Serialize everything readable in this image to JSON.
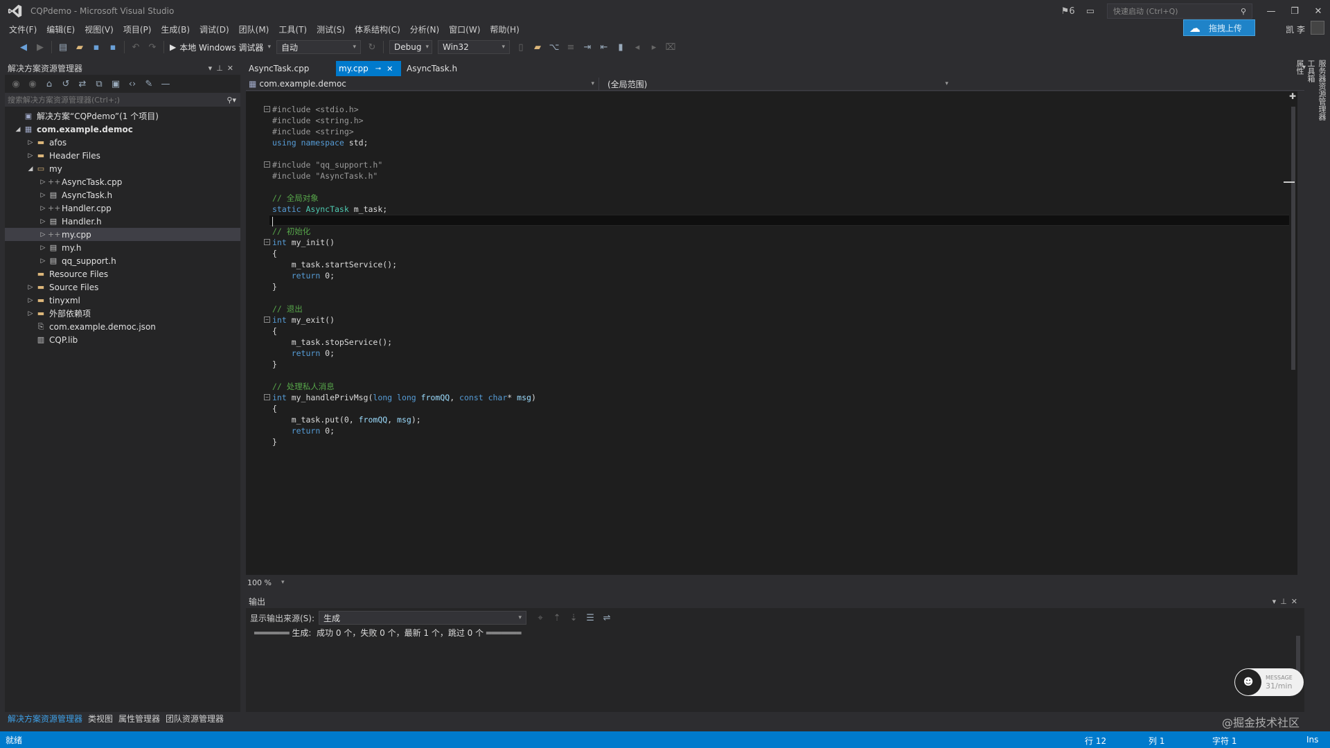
{
  "window": {
    "title": "CQPdemo - Microsoft Visual Studio",
    "notification_count": "6",
    "quick_launch_placeholder": "快速启动 (Ctrl+Q)",
    "upload_label": "拖拽上传",
    "user_name": "凯 李"
  },
  "menu": [
    "文件(F)",
    "编辑(E)",
    "视图(V)",
    "项目(P)",
    "生成(B)",
    "调试(D)",
    "团队(M)",
    "工具(T)",
    "测试(S)",
    "体系结构(C)",
    "分析(N)",
    "窗口(W)",
    "帮助(H)"
  ],
  "toolbar": {
    "run_label": "本地 Windows 调试器",
    "run_mode": "自动",
    "configuration": "Debug",
    "platform": "Win32"
  },
  "solution_explorer": {
    "title": "解决方案资源管理器",
    "search_placeholder": "搜索解决方案资源管理器(Ctrl+;)",
    "items": [
      {
        "label": "解决方案“CQPdemo”(1 个项目)",
        "depth": 0,
        "twisty": "",
        "icon": "solution-icon",
        "glyph": "▣",
        "cls": "ic-proj",
        "bold": false,
        "selected": false
      },
      {
        "label": "com.example.democ",
        "depth": 0,
        "twisty": "◢",
        "icon": "project-icon",
        "glyph": "▦",
        "cls": "ic-proj",
        "bold": true,
        "selected": false
      },
      {
        "label": "afos",
        "depth": 1,
        "twisty": "▷",
        "icon": "folder-icon",
        "glyph": "▬",
        "cls": "ic-folder",
        "bold": false,
        "selected": false
      },
      {
        "label": "Header Files",
        "depth": 1,
        "twisty": "▷",
        "icon": "folder-icon",
        "glyph": "▬",
        "cls": "ic-folder",
        "bold": false,
        "selected": false
      },
      {
        "label": "my",
        "depth": 1,
        "twisty": "◢",
        "icon": "folder-open-icon",
        "glyph": "▭",
        "cls": "ic-folder",
        "bold": false,
        "selected": false
      },
      {
        "label": "AsyncTask.cpp",
        "depth": 2,
        "twisty": "▷",
        "icon": "cpp-file-icon",
        "glyph": "++",
        "cls": "ic-cpp",
        "bold": false,
        "selected": false
      },
      {
        "label": "AsyncTask.h",
        "depth": 2,
        "twisty": "▷",
        "icon": "header-file-icon",
        "glyph": "▤",
        "cls": "ic-file",
        "bold": false,
        "selected": false
      },
      {
        "label": "Handler.cpp",
        "depth": 2,
        "twisty": "▷",
        "icon": "cpp-file-icon",
        "glyph": "++",
        "cls": "ic-cpp",
        "bold": false,
        "selected": false
      },
      {
        "label": "Handler.h",
        "depth": 2,
        "twisty": "▷",
        "icon": "header-file-icon",
        "glyph": "▤",
        "cls": "ic-file",
        "bold": false,
        "selected": false
      },
      {
        "label": "my.cpp",
        "depth": 2,
        "twisty": "▷",
        "icon": "cpp-file-icon",
        "glyph": "++",
        "cls": "ic-cpp",
        "bold": false,
        "selected": true
      },
      {
        "label": "my.h",
        "depth": 2,
        "twisty": "▷",
        "icon": "header-file-icon",
        "glyph": "▤",
        "cls": "ic-file",
        "bold": false,
        "selected": false
      },
      {
        "label": "qq_support.h",
        "depth": 2,
        "twisty": "▷",
        "icon": "header-file-icon",
        "glyph": "▤",
        "cls": "ic-file",
        "bold": false,
        "selected": false
      },
      {
        "label": "Resource Files",
        "depth": 1,
        "twisty": "",
        "icon": "folder-icon",
        "glyph": "▬",
        "cls": "ic-folder",
        "bold": false,
        "selected": false
      },
      {
        "label": "Source Files",
        "depth": 1,
        "twisty": "▷",
        "icon": "folder-icon",
        "glyph": "▬",
        "cls": "ic-folder",
        "bold": false,
        "selected": false
      },
      {
        "label": "tinyxml",
        "depth": 1,
        "twisty": "▷",
        "icon": "folder-icon",
        "glyph": "▬",
        "cls": "ic-folder",
        "bold": false,
        "selected": false
      },
      {
        "label": "外部依赖项",
        "depth": 1,
        "twisty": "▷",
        "icon": "dependencies-icon",
        "glyph": "▬",
        "cls": "ic-folder",
        "bold": false,
        "selected": false
      },
      {
        "label": "com.example.democ.json",
        "depth": 1,
        "twisty": "",
        "icon": "json-file-icon",
        "glyph": "⎘",
        "cls": "ic-file",
        "bold": false,
        "selected": false
      },
      {
        "label": "CQP.lib",
        "depth": 1,
        "twisty": "",
        "icon": "lib-file-icon",
        "glyph": "▥",
        "cls": "ic-file",
        "bold": false,
        "selected": false
      }
    ],
    "bottom_tabs": [
      "解决方案资源管理器",
      "类视图",
      "属性管理器",
      "团队资源管理器"
    ]
  },
  "editor": {
    "tabs": [
      {
        "label": "AsyncTask.cpp",
        "active": false
      },
      {
        "label": "my.cpp",
        "active": true
      },
      {
        "label": "AsyncTask.h",
        "active": false
      }
    ],
    "nav_project": "com.example.democ",
    "nav_scope": "(全局范围)",
    "zoom": "100 %",
    "code_lines": [
      [
        {
          "t": "#include ",
          "c": "pp"
        },
        {
          "t": "<stdio.h>",
          "c": "pp"
        }
      ],
      [
        {
          "t": "#include ",
          "c": "pp"
        },
        {
          "t": "<string.h>",
          "c": "pp"
        }
      ],
      [
        {
          "t": "#include ",
          "c": "pp"
        },
        {
          "t": "<string>",
          "c": "pp"
        }
      ],
      [
        {
          "t": "using namespace",
          "c": "kw"
        },
        {
          "t": " std;",
          "c": "plain"
        }
      ],
      [],
      [
        {
          "t": "#include ",
          "c": "pp"
        },
        {
          "t": "\"qq_support.h\"",
          "c": "pp"
        }
      ],
      [
        {
          "t": "#include ",
          "c": "pp"
        },
        {
          "t": "\"AsyncTask.h\"",
          "c": "pp"
        }
      ],
      [],
      [
        {
          "t": "// 全局对象",
          "c": "cm"
        }
      ],
      [
        {
          "t": "static",
          "c": "kw"
        },
        {
          "t": " AsyncTask",
          "c": "ty"
        },
        {
          "t": " m_task;",
          "c": "plain"
        }
      ],
      [],
      [
        {
          "t": "// 初始化",
          "c": "cm"
        }
      ],
      [
        {
          "t": "int",
          "c": "kw"
        },
        {
          "t": " my_init()",
          "c": "plain"
        }
      ],
      [
        {
          "t": "{",
          "c": "plain"
        }
      ],
      [
        {
          "t": "    m_task.startService();",
          "c": "plain"
        }
      ],
      [
        {
          "t": "    ",
          "c": "plain"
        },
        {
          "t": "return",
          "c": "kw"
        },
        {
          "t": " 0;",
          "c": "plain"
        }
      ],
      [
        {
          "t": "}",
          "c": "plain"
        }
      ],
      [],
      [
        {
          "t": "// 退出",
          "c": "cm"
        }
      ],
      [
        {
          "t": "int",
          "c": "kw"
        },
        {
          "t": " my_exit()",
          "c": "plain"
        }
      ],
      [
        {
          "t": "{",
          "c": "plain"
        }
      ],
      [
        {
          "t": "    m_task.stopService();",
          "c": "plain"
        }
      ],
      [
        {
          "t": "    ",
          "c": "plain"
        },
        {
          "t": "return",
          "c": "kw"
        },
        {
          "t": " 0;",
          "c": "plain"
        }
      ],
      [
        {
          "t": "}",
          "c": "plain"
        }
      ],
      [],
      [
        {
          "t": "// 处理私人消息",
          "c": "cm"
        }
      ],
      [
        {
          "t": "int",
          "c": "kw"
        },
        {
          "t": " my_handlePrivMsg(",
          "c": "plain"
        },
        {
          "t": "long long",
          "c": "kw"
        },
        {
          "t": " fromQQ",
          "c": "par"
        },
        {
          "t": ", ",
          "c": "plain"
        },
        {
          "t": "const char",
          "c": "kw"
        },
        {
          "t": "* ",
          "c": "plain"
        },
        {
          "t": "msg",
          "c": "par"
        },
        {
          "t": ")",
          "c": "plain"
        }
      ],
      [
        {
          "t": "{",
          "c": "plain"
        }
      ],
      [
        {
          "t": "    m_task.put(0, ",
          "c": "plain"
        },
        {
          "t": "fromQQ",
          "c": "par"
        },
        {
          "t": ", ",
          "c": "plain"
        },
        {
          "t": "msg",
          "c": "par"
        },
        {
          "t": ");",
          "c": "plain"
        }
      ],
      [
        {
          "t": "    ",
          "c": "plain"
        },
        {
          "t": "return",
          "c": "kw"
        },
        {
          "t": " 0;",
          "c": "plain"
        }
      ],
      [
        {
          "t": "}",
          "c": "plain"
        }
      ]
    ],
    "fold_lines": [
      0,
      5,
      12,
      19,
      26
    ],
    "current_line_index": 10
  },
  "output": {
    "title": "输出",
    "source_label": "显示输出来源(S):",
    "source_value": "生成",
    "text": "═══════ 生成:  成功 0 个，失败 0 个，最新 1 个，跳过 0 个 ═══════"
  },
  "right_strip": [
    "服务器资源管理器",
    "工具箱",
    "属性"
  ],
  "message_widget": {
    "label": "MESSAGE",
    "rate": "31/min"
  },
  "watermark": "@掘金技术社区",
  "status": {
    "text": "就绪",
    "line": "行 12",
    "col": "列 1",
    "char": "字符 1",
    "mode": "Ins"
  }
}
